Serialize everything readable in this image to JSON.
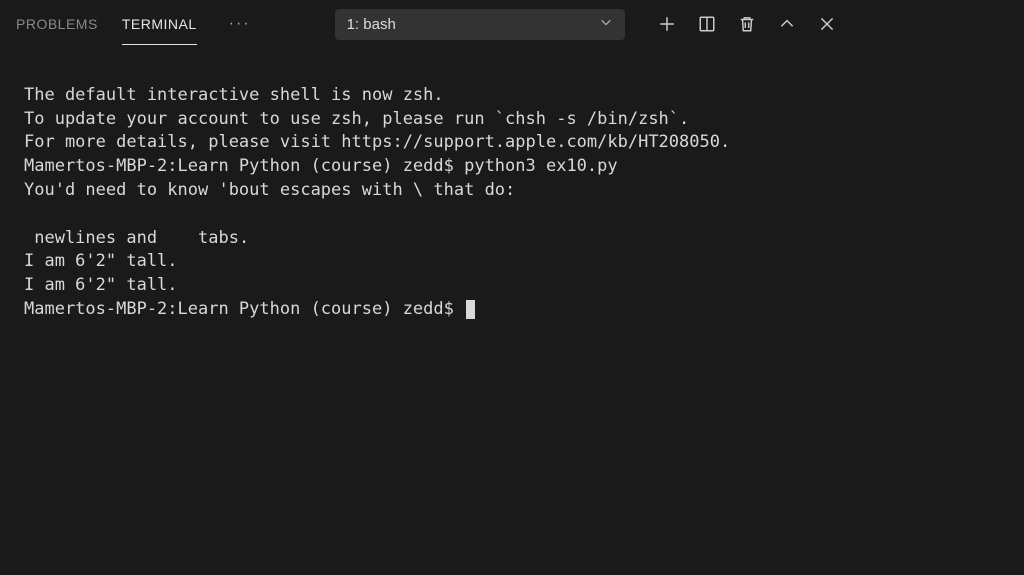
{
  "tabs": {
    "problems": "PROBLEMS",
    "terminal": "TERMINAL"
  },
  "dropdown": {
    "label": "1: bash"
  },
  "terminal": {
    "lines": [
      "",
      "The default interactive shell is now zsh.",
      "To update your account to use zsh, please run `chsh -s /bin/zsh`.",
      "For more details, please visit https://support.apple.com/kb/HT208050.",
      "Mamertos-MBP-2:Learn Python (course) zedd$ python3 ex10.py",
      "You'd need to know 'bout escapes with \\ that do:",
      "",
      " newlines and \t tabs.",
      "I am 6'2\" tall.",
      "I am 6'2\" tall.",
      "Mamertos-MBP-2:Learn Python (course) zedd$ "
    ]
  }
}
